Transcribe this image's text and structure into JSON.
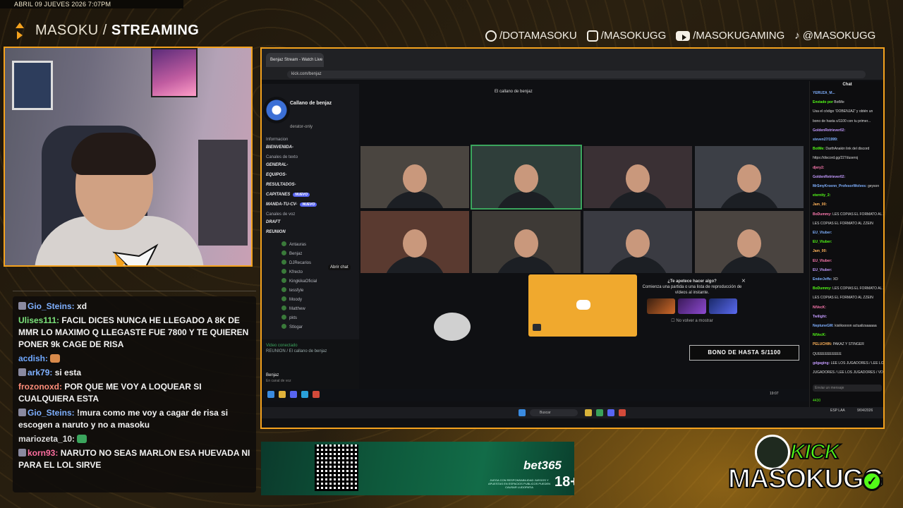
{
  "overlay": {
    "date": "ABRIL 09 JUEVES 2026 7:07PM",
    "brand_light": "MASOKU /",
    "brand_bold": "STREAMING",
    "socials": [
      {
        "icon": "facebook-icon",
        "label": "/DOTAMASOKU"
      },
      {
        "icon": "instagram-icon",
        "label": "/MASOKUGG"
      },
      {
        "icon": "youtube-icon",
        "label": "/MASOKUGAMING"
      },
      {
        "icon": "tiktok-icon",
        "label": "@MASOKUGG"
      }
    ],
    "kick_logo": "KICK",
    "kick_name": "MASOKUGG",
    "accent": "#f4a21e",
    "kick_green": "#53fc18"
  },
  "chat": {
    "messages": [
      {
        "user": "Gio_Steins:",
        "color": "#7fb0ff",
        "text": "xd",
        "badge": true
      },
      {
        "user": "Ulises111:",
        "color": "#7be37b",
        "text": "FACIL DICES NUNCA HE LLEGADO A 8K DE MMR LO MAXIMO Q LLEGASTE FUE 7800 Y TE QUIEREN PONER 9k CAGE DE RISA",
        "badge": false
      },
      {
        "user": "acdish:",
        "color": "#6fa8ff",
        "text": "",
        "badge": false,
        "emote": true
      },
      {
        "user": "ark79:",
        "color": "#7fb0ff",
        "text": "si esta",
        "badge": true
      },
      {
        "user": "frozonoxd:",
        "color": "#ff8e7a",
        "text": "POR QUE ME VOY A LOQUEAR SI CUALQUIERA ESTA",
        "badge": false
      },
      {
        "user": "Gio_Steins:",
        "color": "#7fb0ff",
        "text": "!mura como me voy a cagar de risa si escogen a naruto y no a masoku",
        "badge": true
      },
      {
        "user": "mariozeta_10:",
        "color": "#dddddd",
        "text": "",
        "badge": false,
        "emote": true
      },
      {
        "user": "korn93:",
        "color": "#ff6ea0",
        "text": "NARUTO NO SEAS MARLON ESA HUEVADA NI PARA EL LOL SIRVE",
        "badge": true
      }
    ]
  },
  "screen": {
    "tab_title": "Benjaz Stream - Watch Live",
    "url": "kick.com/benjaz",
    "stage_title": "El callano de benjaz",
    "discord": {
      "server_name": "Callano de benjaz",
      "subtitle": "derator-only",
      "channels": [
        {
          "label": "Informacion",
          "style": "cat"
        },
        {
          "label": "BIENVENIDA-",
          "style": "bold"
        },
        {
          "label": "Canales de texto",
          "style": "cat"
        },
        {
          "label": "GENERAL-",
          "style": "bold"
        },
        {
          "label": "EQUIPOS-",
          "style": "bold"
        },
        {
          "label": "RESULTADOS-",
          "style": "bold"
        },
        {
          "label": "CAPITANES",
          "style": "bold",
          "tag": "NUEVO"
        },
        {
          "label": "MANDA-TU-CV-",
          "style": "bold",
          "tag": "NUEVO"
        },
        {
          "label": "Canales de voz",
          "style": "cat"
        },
        {
          "label": "DRAFT",
          "style": "bold"
        },
        {
          "label": "REUNION",
          "style": "bold"
        }
      ],
      "voice_users": [
        "Antauras",
        "Benjaz",
        "DJRecarios",
        "Kfrecto",
        "KingkikaOficial",
        "tessfyle",
        "Moody",
        "Matthew",
        "pkts",
        "Stlogar"
      ],
      "tooltip": "Abrir chat",
      "voice_connected": "Video conectado",
      "voice_channel": "REUNION / El callano de benjaz",
      "me_name": "Benjaz",
      "me_status": "En canal de voz"
    },
    "popup": {
      "title": "¿Te apetece hacer algo?",
      "body": "Comienza una partida o una lista de reproducción de vídeos al instante.",
      "checkbox": "No volver a mostrar"
    },
    "bono": "BONO DE HASTA S/1100",
    "kick_chat": {
      "header": "Chat",
      "input_placeholder": "Enviar un mensaje",
      "lines": [
        {
          "user": "YERUZA_M...",
          "text": ""
        },
        {
          "user": "Enviado por",
          "text": "BotMe"
        },
        {
          "user": "",
          "text": "Usa el código 'OOBENJAZ' y obtén un"
        },
        {
          "user": "",
          "text": "bono de hasta s/1100 con tu primer..."
        },
        {
          "user": "GoldenRetriever02:",
          "text": ""
        },
        {
          "user": "steven27/1999:",
          "text": ""
        },
        {
          "user": "BotMe:",
          "text": "DarthAnakin link del discord"
        },
        {
          "user": "",
          "text": "https://discord.gg/227duseroj"
        },
        {
          "user": "djery2:",
          "text": ""
        },
        {
          "user": "GoldenRetriever02:",
          "text": ""
        },
        {
          "user": "MrSmyKroenn_ProfesorWolves:",
          "text": "geyson"
        },
        {
          "user": "eternity_2:",
          "text": ""
        },
        {
          "user": "Jam_00:",
          "text": ""
        },
        {
          "user": "BoDummy:",
          "text": "LES COPIAS EL FORMATO AL ZZEIN"
        },
        {
          "user": "",
          "text": "LES COPIAS EL FORMATO AL ZZEIN"
        },
        {
          "user": "EU_Vtuber:",
          "text": ""
        },
        {
          "user": "EU_Vtuber:",
          "text": ""
        },
        {
          "user": "Jam_00:",
          "text": ""
        },
        {
          "user": "EU_Vtuber:",
          "text": ""
        },
        {
          "user": "EU_Vtuber:",
          "text": ""
        },
        {
          "user": "EnderJeffe:",
          "text": "XD"
        },
        {
          "user": "BoDummy:",
          "text": "LES COPIAS EL FORMATO AL ZZEIN"
        },
        {
          "user": "",
          "text": "LES COPIAS EL FORMATO AL ZZEIN"
        },
        {
          "user": "NiVecK:",
          "text": ""
        },
        {
          "user": "Twilight:",
          "text": ""
        },
        {
          "user": "NeptuneGM:",
          "text": "kisiiksooon actualizaaaaaa"
        },
        {
          "user": "NiVecK:",
          "text": ""
        },
        {
          "user": "PELUCHIN:",
          "text": "PAKAZ Y STINGER"
        },
        {
          "user": "",
          "text": "QUEEEEEEEEEE"
        },
        {
          "user": "gdgaging:",
          "text": "LEE LOS JUGADORES / LEE LOS"
        },
        {
          "user": "",
          "text": "JUGADORES / LEE LOS JUGADORES / VD"
        }
      ],
      "viewers": "4430"
    },
    "taskbar": {
      "search": "Buscar",
      "clock": "19:07",
      "date": "9/04/2026",
      "lang": "ESP LAA"
    }
  },
  "ad": {
    "brand": "bet365",
    "age": "18+",
    "fine": "JUEGA CON RESPONSABILIDAD JUEGOS Y APUESTAS EN ESPACIOS PUBLICOS PUEDEN CAUSAR LUDOPATIA"
  }
}
